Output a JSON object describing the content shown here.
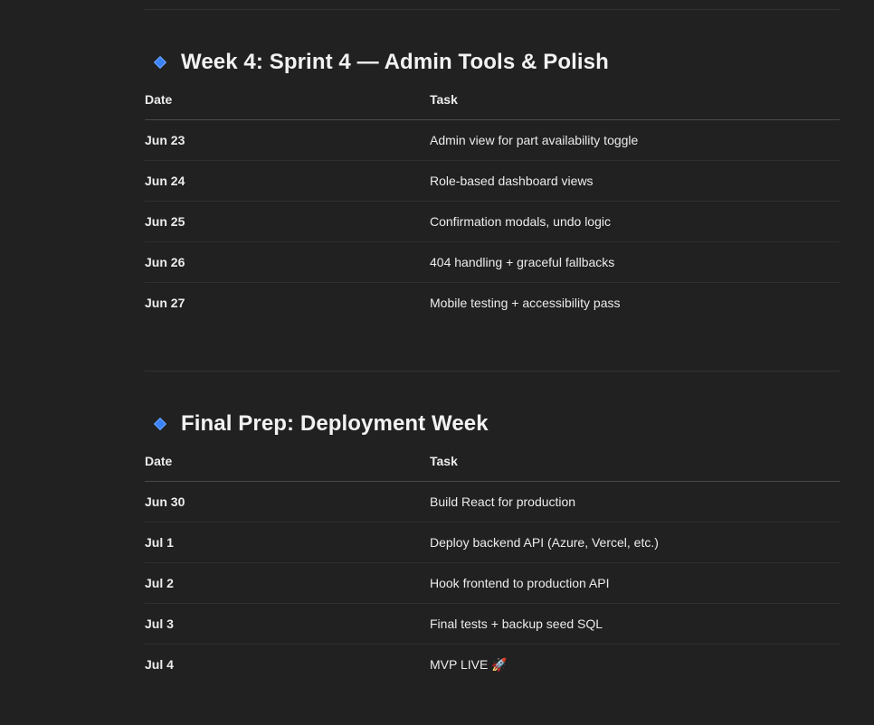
{
  "sections": [
    {
      "title": "Week 4: Sprint 4 — Admin Tools & Polish",
      "headers": {
        "date": "Date",
        "task": "Task"
      },
      "rows": [
        {
          "date": "Jun 23",
          "task": "Admin view for part availability toggle"
        },
        {
          "date": "Jun 24",
          "task": "Role-based dashboard views"
        },
        {
          "date": "Jun 25",
          "task": "Confirmation modals, undo logic"
        },
        {
          "date": "Jun 26",
          "task": "404 handling + graceful fallbacks"
        },
        {
          "date": "Jun 27",
          "task": "Mobile testing + accessibility pass"
        }
      ]
    },
    {
      "title": "Final Prep: Deployment Week",
      "headers": {
        "date": "Date",
        "task": "Task"
      },
      "rows": [
        {
          "date": "Jun 30",
          "task": "Build React for production"
        },
        {
          "date": "Jul 1",
          "task": "Deploy backend API (Azure, Vercel, etc.)"
        },
        {
          "date": "Jul 2",
          "task": "Hook frontend to production API"
        },
        {
          "date": "Jul 3",
          "task": "Final tests + backup seed SQL"
        },
        {
          "date": "Jul 4",
          "task": "MVP LIVE 🚀"
        }
      ]
    }
  ],
  "colors": {
    "background": "#212121",
    "text": "#ececec",
    "bullet_accent": "#3b82f6"
  },
  "icons": {
    "section_bullet": "blue-diamond-icon"
  }
}
